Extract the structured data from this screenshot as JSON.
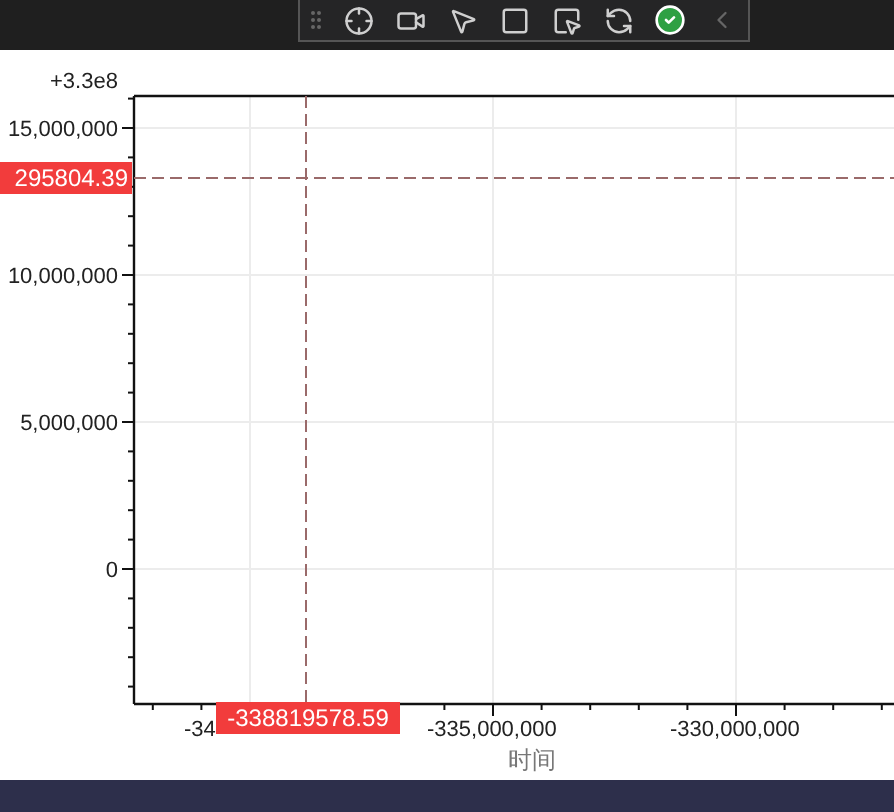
{
  "chart": {
    "offset_label": "+3.3e8",
    "y_ticks": [
      "15,000,000",
      "10,000,000",
      "5,000,000",
      "0"
    ],
    "x_ticks": [
      "-34",
      "-335,000,000",
      "-330,000,000"
    ],
    "xlabel": "时间",
    "crosshair": {
      "x_label": "-338819578.59",
      "y_label": "295804.39"
    }
  }
}
